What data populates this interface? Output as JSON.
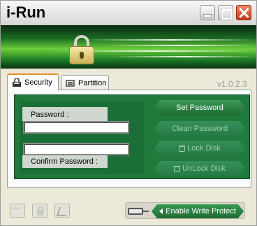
{
  "window": {
    "title": "i-Run"
  },
  "tabs": [
    {
      "label": "Security",
      "icon": "lock-icon",
      "selected": true
    },
    {
      "label": "Partition",
      "icon": "drive-icon",
      "selected": false
    }
  ],
  "version": "v1.0.2.3",
  "form": {
    "password_label": "Password :",
    "password_value": "",
    "confirm_label": "Confirm Password :",
    "confirm_value": ""
  },
  "actions": {
    "set_password": "Set Password",
    "clean_password": "Clean Password",
    "lock_disk": "Lock Disk",
    "unlock_disk": "UnLock Disk"
  },
  "write_protect": {
    "label": "Enable Write Protect"
  },
  "colors": {
    "plate": "#1f7a3c",
    "button_text_disabled": "#9fd0ad",
    "active_tab_accent": "#e68b2c"
  }
}
